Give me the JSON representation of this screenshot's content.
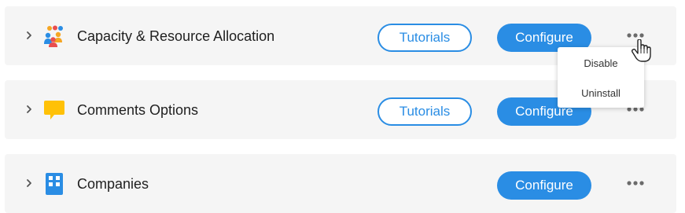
{
  "apps": [
    {
      "name": "Capacity & Resource Allocation",
      "icon": "people-group-icon",
      "tutorials_label": "Tutorials",
      "configure_label": "Configure"
    },
    {
      "name": "Comments Options",
      "icon": "comment-icon",
      "tutorials_label": "Tutorials",
      "configure_label": "Configure"
    },
    {
      "name": "Companies",
      "icon": "building-icon",
      "configure_label": "Configure"
    }
  ],
  "more_menu": {
    "items": [
      "Disable",
      "Uninstall"
    ]
  },
  "colors": {
    "accent": "#2a8de4",
    "row_background": "#f5f5f5",
    "comment_icon": "#ffc107"
  }
}
